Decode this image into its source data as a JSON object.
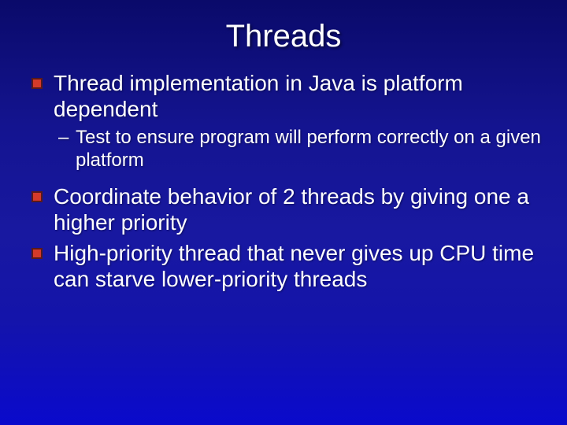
{
  "slide": {
    "title": "Threads",
    "bullets": [
      {
        "level": 1,
        "text": "Thread implementation in Java is platform dependent"
      },
      {
        "level": 2,
        "text": "Test to ensure program will perform correctly on a given platform"
      },
      {
        "level": 1,
        "text": "Coordinate behavior of 2 threads by giving one a higher priority"
      },
      {
        "level": 1,
        "text": "High-priority thread that never gives up CPU time can starve lower-priority threads"
      }
    ]
  }
}
